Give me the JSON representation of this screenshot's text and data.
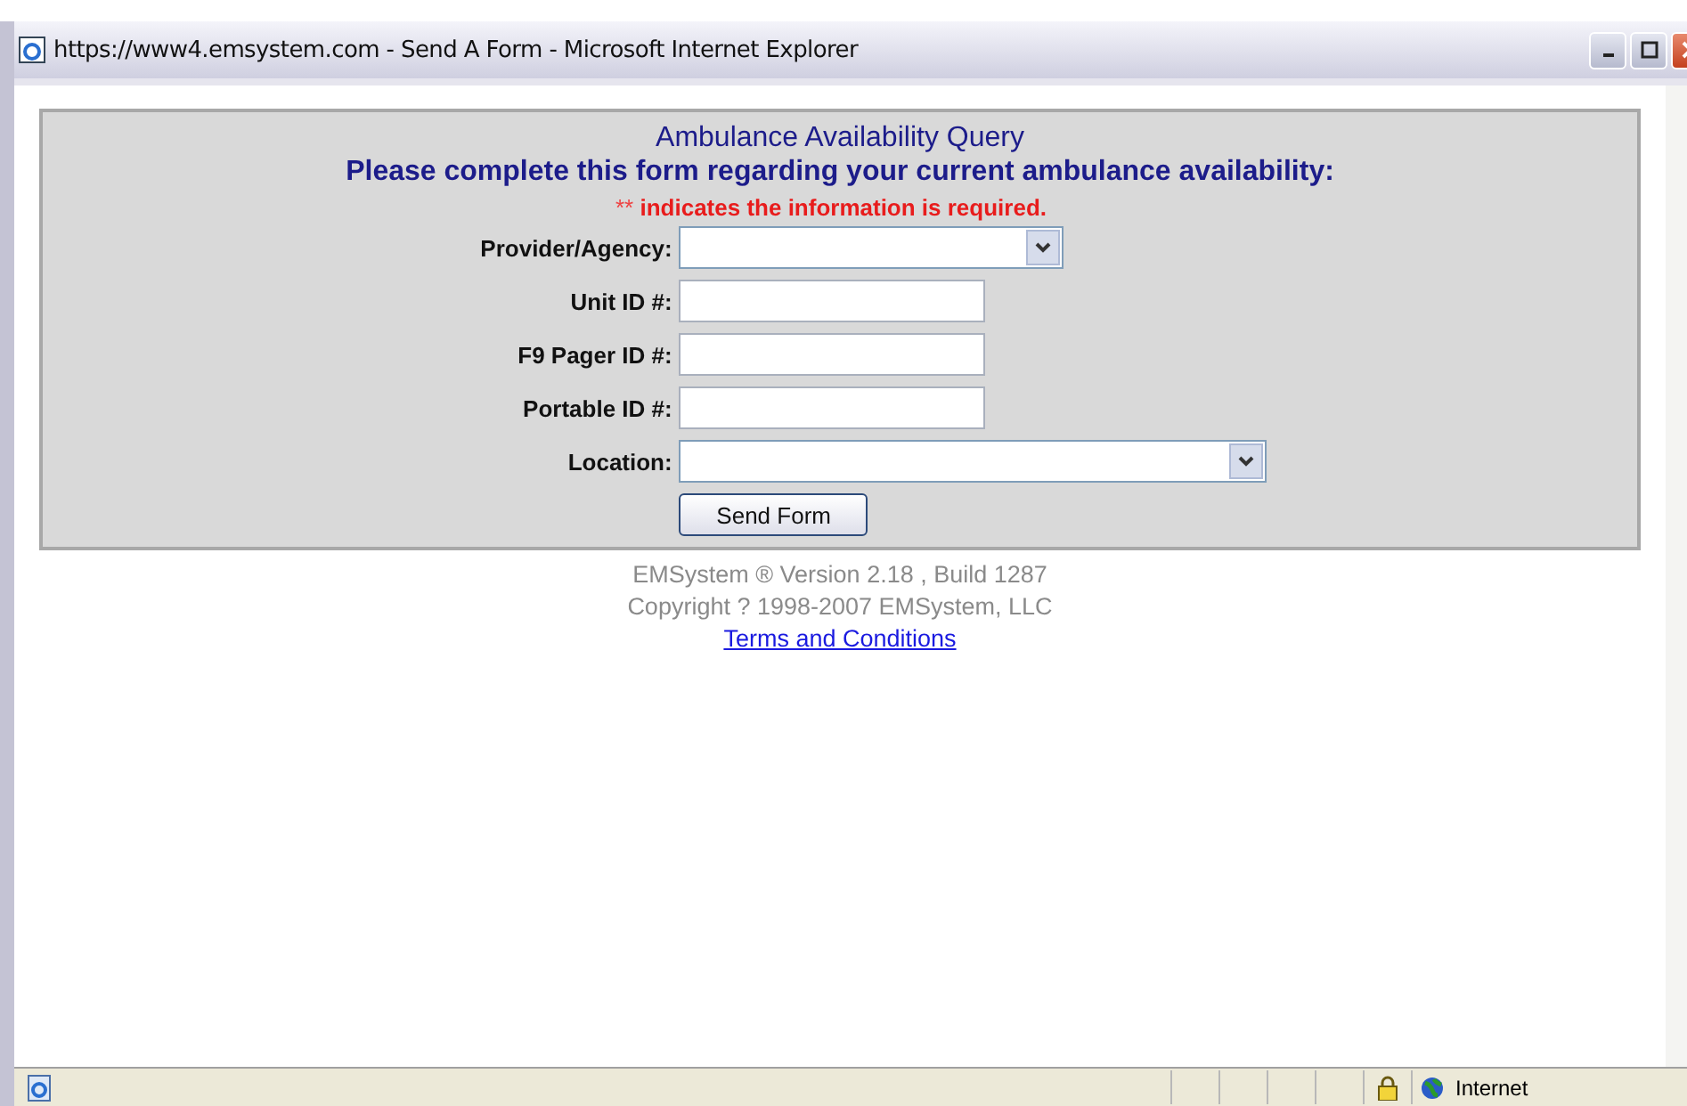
{
  "window": {
    "title": "https://www4.emsystem.com - Send A Form - Microsoft Internet Explorer"
  },
  "form": {
    "title": "Ambulance Availability Query",
    "subtitle": "Please complete this form regarding your current ambulance availability:",
    "required_mark": "**",
    "required_note": "indicates the information is required.",
    "fields": [
      {
        "label": "Provider/Agency:",
        "kind": "select"
      },
      {
        "label": "Unit ID #:",
        "kind": "text"
      },
      {
        "label": "F9 Pager ID #:",
        "kind": "text"
      },
      {
        "label": "Portable ID #:",
        "kind": "text"
      },
      {
        "label": "Location:",
        "kind": "wide_select"
      }
    ],
    "submit": "Send Form"
  },
  "footer": {
    "version": "EMSystem ® Version 2.18  , Build 1287",
    "copyright": "Copyright ? 1998-2007 EMSystem, LLC",
    "link": "Terms and Conditions"
  },
  "status_bar": {
    "zone": "Internet"
  }
}
